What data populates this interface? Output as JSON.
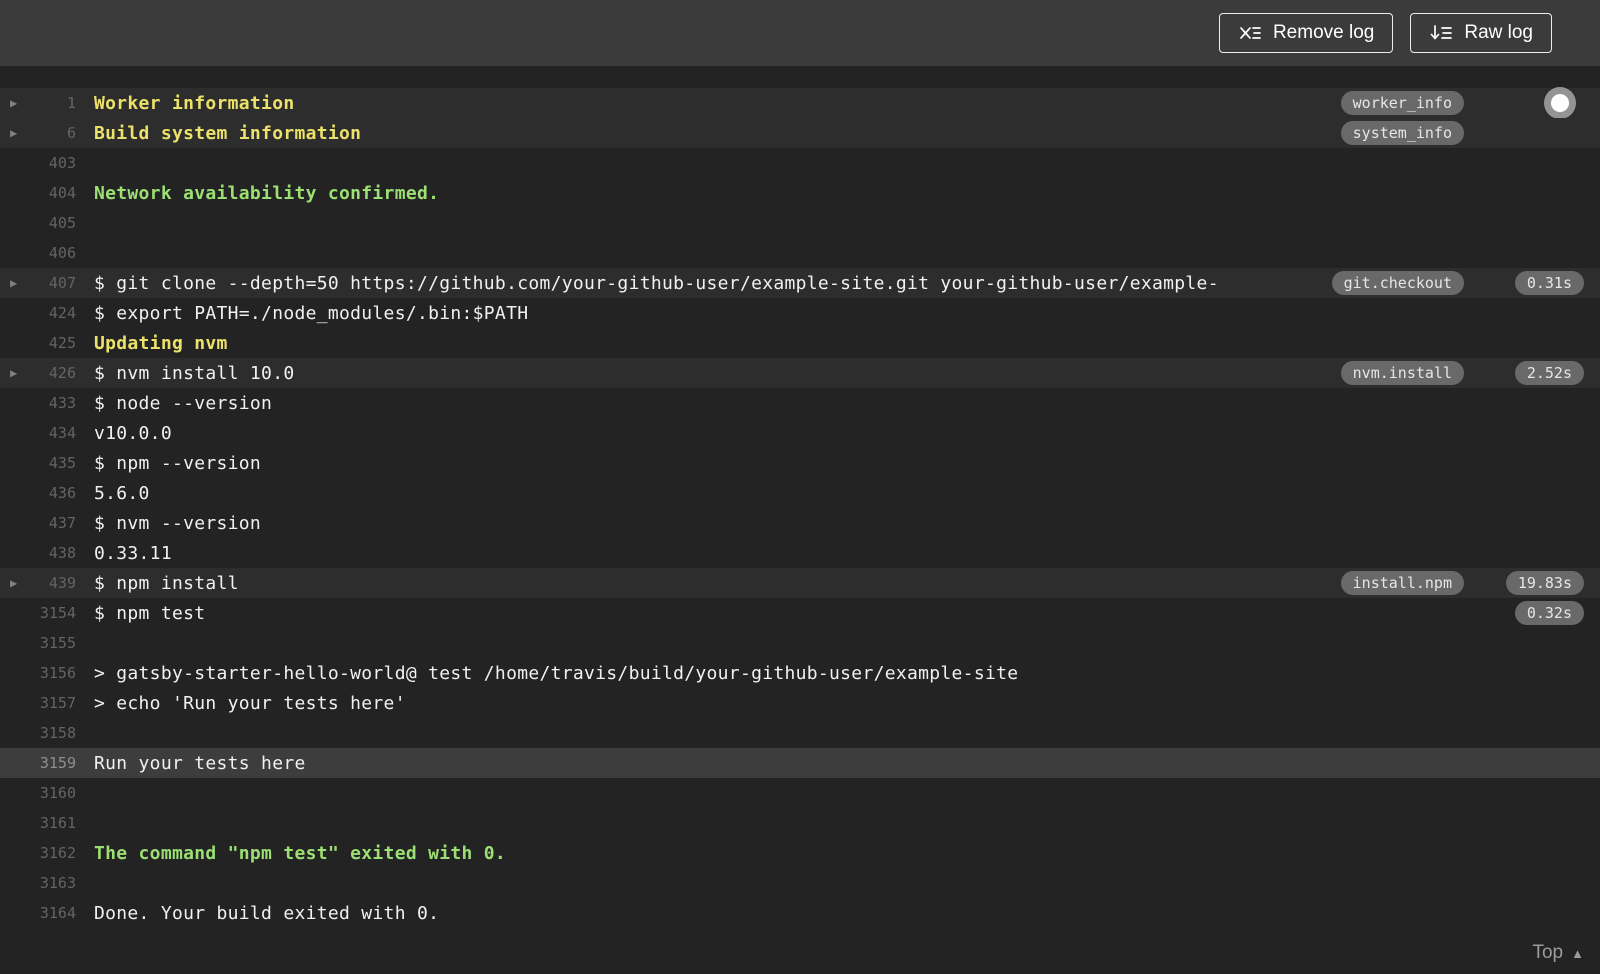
{
  "colors": {
    "toolbar_bg": "#3b3b3b",
    "log_bg": "#232323",
    "fold_header_row_bg": "#2d2d2d",
    "selected_row_bg": "#3d3d3d",
    "default_text": "#f1f1f1",
    "section_yellow": "#ece26a",
    "success_green": "#9cdf73",
    "line_number": "#646464",
    "badge_bg": "#696969",
    "badge_text": "#e6e6e6"
  },
  "toolbar": {
    "remove_log_label": "Remove log",
    "remove_log_icon": "x-with-lines-icon",
    "raw_log_label": "Raw log",
    "raw_log_icon": "download-arrow-with-lines-icon"
  },
  "log": {
    "lines": [
      {
        "num": "1",
        "text": "Worker information",
        "style": "yellow",
        "fold": true,
        "highlight": true,
        "tag": "worker_info",
        "marker": true
      },
      {
        "num": "6",
        "text": "Build system information",
        "style": "yellow",
        "fold": true,
        "highlight": true,
        "tag": "system_info"
      },
      {
        "num": "403",
        "text": ""
      },
      {
        "num": "404",
        "text": "Network availability confirmed.",
        "style": "green"
      },
      {
        "num": "405",
        "text": ""
      },
      {
        "num": "406",
        "text": ""
      },
      {
        "num": "407",
        "text": "$ git clone --depth=50 https://github.com/your-github-user/example-site.git your-github-user/example-",
        "fold": true,
        "highlight": true,
        "tag": "git.checkout",
        "time": "0.31s"
      },
      {
        "num": "424",
        "text": "$ export PATH=./node_modules/.bin:$PATH"
      },
      {
        "num": "425",
        "text": "Updating nvm",
        "style": "yellow"
      },
      {
        "num": "426",
        "text": "$ nvm install 10.0",
        "fold": true,
        "highlight": true,
        "tag": "nvm.install",
        "time": "2.52s"
      },
      {
        "num": "433",
        "text": "$ node --version"
      },
      {
        "num": "434",
        "text": "v10.0.0"
      },
      {
        "num": "435",
        "text": "$ npm --version"
      },
      {
        "num": "436",
        "text": "5.6.0"
      },
      {
        "num": "437",
        "text": "$ nvm --version"
      },
      {
        "num": "438",
        "text": "0.33.11"
      },
      {
        "num": "439",
        "text": "$ npm install",
        "fold": true,
        "highlight": true,
        "tag": "install.npm",
        "time": "19.83s"
      },
      {
        "num": "3154",
        "text": "$ npm test",
        "time": "0.32s"
      },
      {
        "num": "3155",
        "text": ""
      },
      {
        "num": "3156",
        "text": "> gatsby-starter-hello-world@ test /home/travis/build/your-github-user/example-site"
      },
      {
        "num": "3157",
        "text": "> echo 'Run your tests here'"
      },
      {
        "num": "3158",
        "text": ""
      },
      {
        "num": "3159",
        "text": "Run your tests here",
        "selected": true
      },
      {
        "num": "3160",
        "text": ""
      },
      {
        "num": "3161",
        "text": ""
      },
      {
        "num": "3162",
        "text": "The command \"npm test\" exited with 0.",
        "style": "green"
      },
      {
        "num": "3163",
        "text": ""
      },
      {
        "num": "3164",
        "text": "Done. Your build exited with 0."
      }
    ]
  },
  "footer": {
    "top_label": "Top",
    "top_icon": "up-triangle-icon"
  }
}
